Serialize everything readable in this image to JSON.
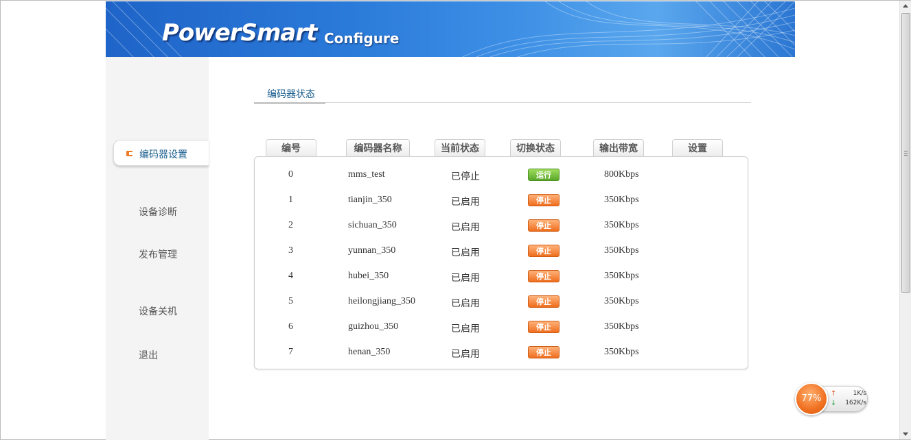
{
  "banner": {
    "logo": "PowerSmart",
    "subtitle": "Configure"
  },
  "sidebar": {
    "items": [
      {
        "label": "编码器设置",
        "active": true
      },
      {
        "label": "设备诊断"
      },
      {
        "label": "发布管理"
      },
      {
        "label": "设备关机"
      },
      {
        "label": "退出"
      }
    ]
  },
  "main": {
    "section_title": "编码器状态",
    "columns": [
      "编号",
      "编码器名称",
      "当前状态",
      "切换状态",
      "输出带宽",
      "设置"
    ],
    "rows": [
      {
        "id": "0",
        "name": "mms_test",
        "state": "已停止",
        "action": "运行",
        "bandwidth": "800Kbps"
      },
      {
        "id": "1",
        "name": "tianjin_350",
        "state": "已启用",
        "action": "停止",
        "bandwidth": "350Kbps"
      },
      {
        "id": "2",
        "name": "sichuan_350",
        "state": "已启用",
        "action": "停止",
        "bandwidth": "350Kbps"
      },
      {
        "id": "3",
        "name": "yunnan_350",
        "state": "已启用",
        "action": "停止",
        "bandwidth": "350Kbps"
      },
      {
        "id": "4",
        "name": "hubei_350",
        "state": "已启用",
        "action": "停止",
        "bandwidth": "350Kbps"
      },
      {
        "id": "5",
        "name": "heilongjiang_350",
        "state": "已启用",
        "action": "停止",
        "bandwidth": "350Kbps"
      },
      {
        "id": "6",
        "name": "guizhou_350",
        "state": "已启用",
        "action": "停止",
        "bandwidth": "350Kbps"
      },
      {
        "id": "7",
        "name": "henan_350",
        "state": "已启用",
        "action": "停止",
        "bandwidth": "350Kbps"
      }
    ]
  },
  "widget": {
    "percent": "77%",
    "upload": "1K/s",
    "download": "162K/s",
    "up_icon": "up-arrow-icon",
    "down_icon": "down-arrow-icon"
  },
  "colors": {
    "accent": "#f07a26",
    "run_button": "#5aa82a",
    "stop_button": "#ee6e1e",
    "link_text": "#1a5e8e",
    "banner_blue": "#2a7ad9"
  }
}
